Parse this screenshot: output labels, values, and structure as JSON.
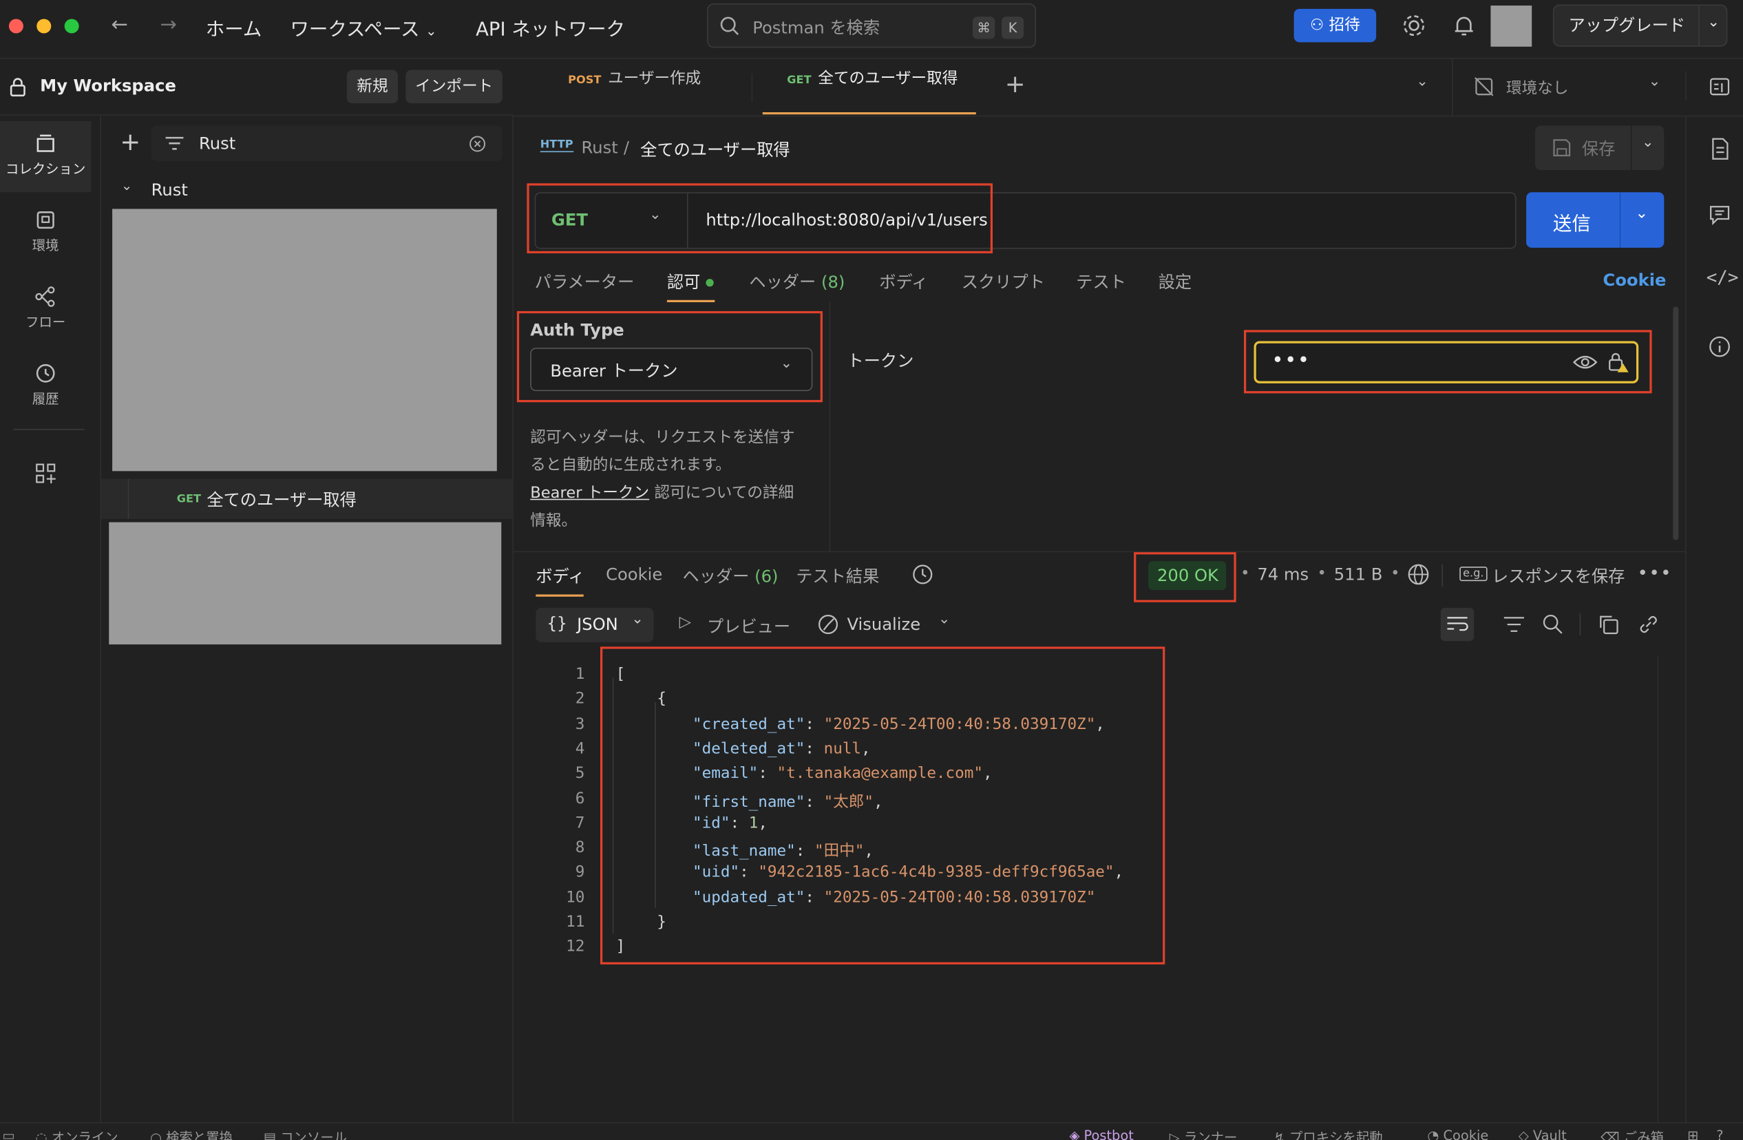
{
  "titlebar": {
    "nav": {
      "home": "ホーム",
      "workspaces": "ワークスペース",
      "api_network": "API ネットワーク"
    },
    "search_placeholder": "Postman を検索",
    "search_kbd": [
      "⌘",
      "K"
    ],
    "invite": "招待",
    "upgrade": "アップグレード"
  },
  "workspace": {
    "name": "My Workspace",
    "new": "新規",
    "import": "インポート"
  },
  "rail": [
    {
      "label": "コレクション",
      "icon": "collections-icon"
    },
    {
      "label": "環境",
      "icon": "environment-icon"
    },
    {
      "label": "フロー",
      "icon": "flows-icon"
    },
    {
      "label": "履歴",
      "icon": "history-icon"
    }
  ],
  "sidebar": {
    "filter_value": "Rust",
    "collection": "Rust",
    "request": {
      "method": "GET",
      "name": "全てのユーザー取得"
    }
  },
  "tabs": [
    {
      "method": "POST",
      "name": "ユーザー作成"
    },
    {
      "method": "GET",
      "name": "全てのユーザー取得"
    }
  ],
  "environment": "環境なし",
  "breadcrumb": {
    "protocol": "HTTP",
    "collection": "Rust",
    "request": "全てのユーザー取得"
  },
  "save": "保存",
  "request": {
    "method": "GET",
    "url": "http://localhost:8080/api/v1/users",
    "send": "送信"
  },
  "request_tabs": {
    "params": "パラメーター",
    "auth": "認可",
    "headers": "ヘッダー",
    "headers_count": "(8)",
    "body": "ボディ",
    "scripts": "スクリプト",
    "tests": "テスト",
    "settings": "設定",
    "cookies": "Cookie"
  },
  "auth": {
    "type_label": "Auth Type",
    "type_value": "Bearer トークン",
    "help_line1": "認可ヘッダーは、リクエストを送信す",
    "help_line2": "ると自動的に生成されます。",
    "help_link": "Bearer トークン",
    "help_rest": " 認可についての詳細",
    "help_line4": "情報。",
    "token_label": "トークン",
    "token_value": "•••"
  },
  "response": {
    "tabs": {
      "body": "ボディ",
      "cookies": "Cookie",
      "headers": "ヘッダー",
      "headers_count": "(6)",
      "tests": "テスト結果"
    },
    "status": "200 OK",
    "time": "74 ms",
    "size": "511 B",
    "save": "レスポンスを保存",
    "format": "JSON",
    "preview": "プレビュー",
    "visualize": "Visualize"
  },
  "code_lines": [
    {
      "n": "1",
      "indent": 0,
      "parts": [
        [
          "punc",
          "["
        ]
      ]
    },
    {
      "n": "2",
      "indent": 1,
      "parts": [
        [
          "punc",
          "{"
        ]
      ]
    },
    {
      "n": "3",
      "indent": 2,
      "parts": [
        [
          "key",
          "\"created_at\""
        ],
        [
          "punc",
          ": "
        ],
        [
          "str",
          "\"2025-05-24T00:40:58.039170Z\""
        ],
        [
          "punc",
          ","
        ]
      ]
    },
    {
      "n": "4",
      "indent": 2,
      "parts": [
        [
          "key",
          "\"deleted_at\""
        ],
        [
          "punc",
          ": "
        ],
        [
          "nul",
          "null"
        ],
        [
          "punc",
          ","
        ]
      ]
    },
    {
      "n": "5",
      "indent": 2,
      "parts": [
        [
          "key",
          "\"email\""
        ],
        [
          "punc",
          ": "
        ],
        [
          "str",
          "\"t.tanaka@example.com\""
        ],
        [
          "punc",
          ","
        ]
      ]
    },
    {
      "n": "6",
      "indent": 2,
      "parts": [
        [
          "key",
          "\"first_name\""
        ],
        [
          "punc",
          ": "
        ],
        [
          "str",
          "\"太郎\""
        ],
        [
          "punc",
          ","
        ]
      ]
    },
    {
      "n": "7",
      "indent": 2,
      "parts": [
        [
          "key",
          "\"id\""
        ],
        [
          "punc",
          ": "
        ],
        [
          "num",
          "1"
        ],
        [
          "punc",
          ","
        ]
      ]
    },
    {
      "n": "8",
      "indent": 2,
      "parts": [
        [
          "key",
          "\"last_name\""
        ],
        [
          "punc",
          ": "
        ],
        [
          "str",
          "\"田中\""
        ],
        [
          "punc",
          ","
        ]
      ]
    },
    {
      "n": "9",
      "indent": 2,
      "parts": [
        [
          "key",
          "\"uid\""
        ],
        [
          "punc",
          ": "
        ],
        [
          "str",
          "\"942c2185-1ac6-4c4b-9385-deff9cf965ae\""
        ],
        [
          "punc",
          ","
        ]
      ]
    },
    {
      "n": "10",
      "indent": 2,
      "parts": [
        [
          "key",
          "\"updated_at\""
        ],
        [
          "punc",
          ": "
        ],
        [
          "str",
          "\"2025-05-24T00:40:58.039170Z\""
        ]
      ]
    },
    {
      "n": "11",
      "indent": 1,
      "parts": [
        [
          "punc",
          "}"
        ]
      ]
    },
    {
      "n": "12",
      "indent": 0,
      "parts": [
        [
          "punc",
          "]"
        ]
      ]
    }
  ],
  "statusbar": {
    "online": "オンライン",
    "find": "検索と置換",
    "console": "コンソール",
    "postbot": "Postbot",
    "runner": "ランナー",
    "proxy": "プロキシを起動",
    "cookies": "Cookie",
    "vault": "Vault",
    "trash": "ごみ箱"
  }
}
